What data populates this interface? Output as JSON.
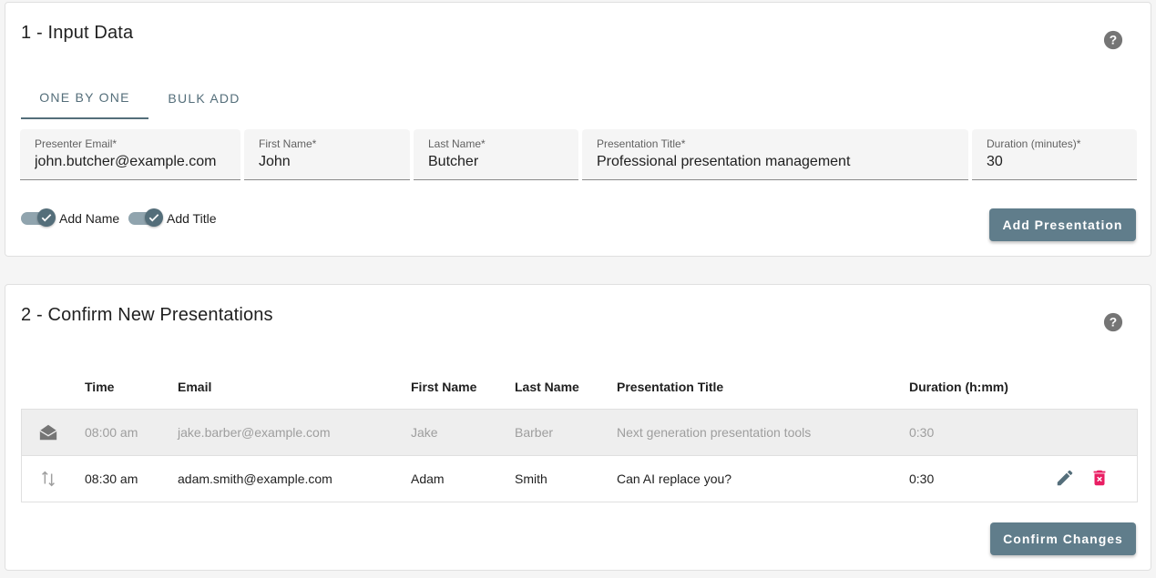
{
  "section1": {
    "title": "1 - Input Data",
    "tabs": [
      {
        "label": "ONE BY ONE",
        "active": true
      },
      {
        "label": "BULK ADD",
        "active": false
      }
    ],
    "fields": {
      "email": {
        "label": "Presenter Email*",
        "value": "john.butcher@example.com"
      },
      "first_name": {
        "label": "First Name*",
        "value": "John"
      },
      "last_name": {
        "label": "Last Name*",
        "value": "Butcher"
      },
      "title": {
        "label": "Presentation Title*",
        "value": "Professional presentation management"
      },
      "duration": {
        "label": "Duration (minutes)*",
        "value": "30"
      }
    },
    "toggles": {
      "add_name": {
        "label": "Add Name",
        "on": true
      },
      "add_title": {
        "label": "Add Title",
        "on": true
      }
    },
    "add_button": "Add Presentation"
  },
  "section2": {
    "title": "2 - Confirm New Presentations",
    "columns": [
      "Time",
      "Email",
      "First Name",
      "Last Name",
      "Presentation Title",
      "Duration (h:mm)"
    ],
    "rows": [
      {
        "icon": "envelope-open-icon",
        "time": "08:00 am",
        "email": "jake.barber@example.com",
        "first_name": "Jake",
        "last_name": "Barber",
        "title": "Next generation presentation tools",
        "duration": "0:30",
        "state": "disabled"
      },
      {
        "icon": "swap-vertical-icon",
        "time": "08:30 am",
        "email": "adam.smith@example.com",
        "first_name": "Adam",
        "last_name": "Smith",
        "title": "Can AI replace you?",
        "duration": "0:30",
        "state": "normal"
      }
    ],
    "confirm_button": "Confirm Changes"
  },
  "colors": {
    "primary": "#607d8b",
    "delete": "#e91e63",
    "disabled_text": "#9e9e9e"
  }
}
